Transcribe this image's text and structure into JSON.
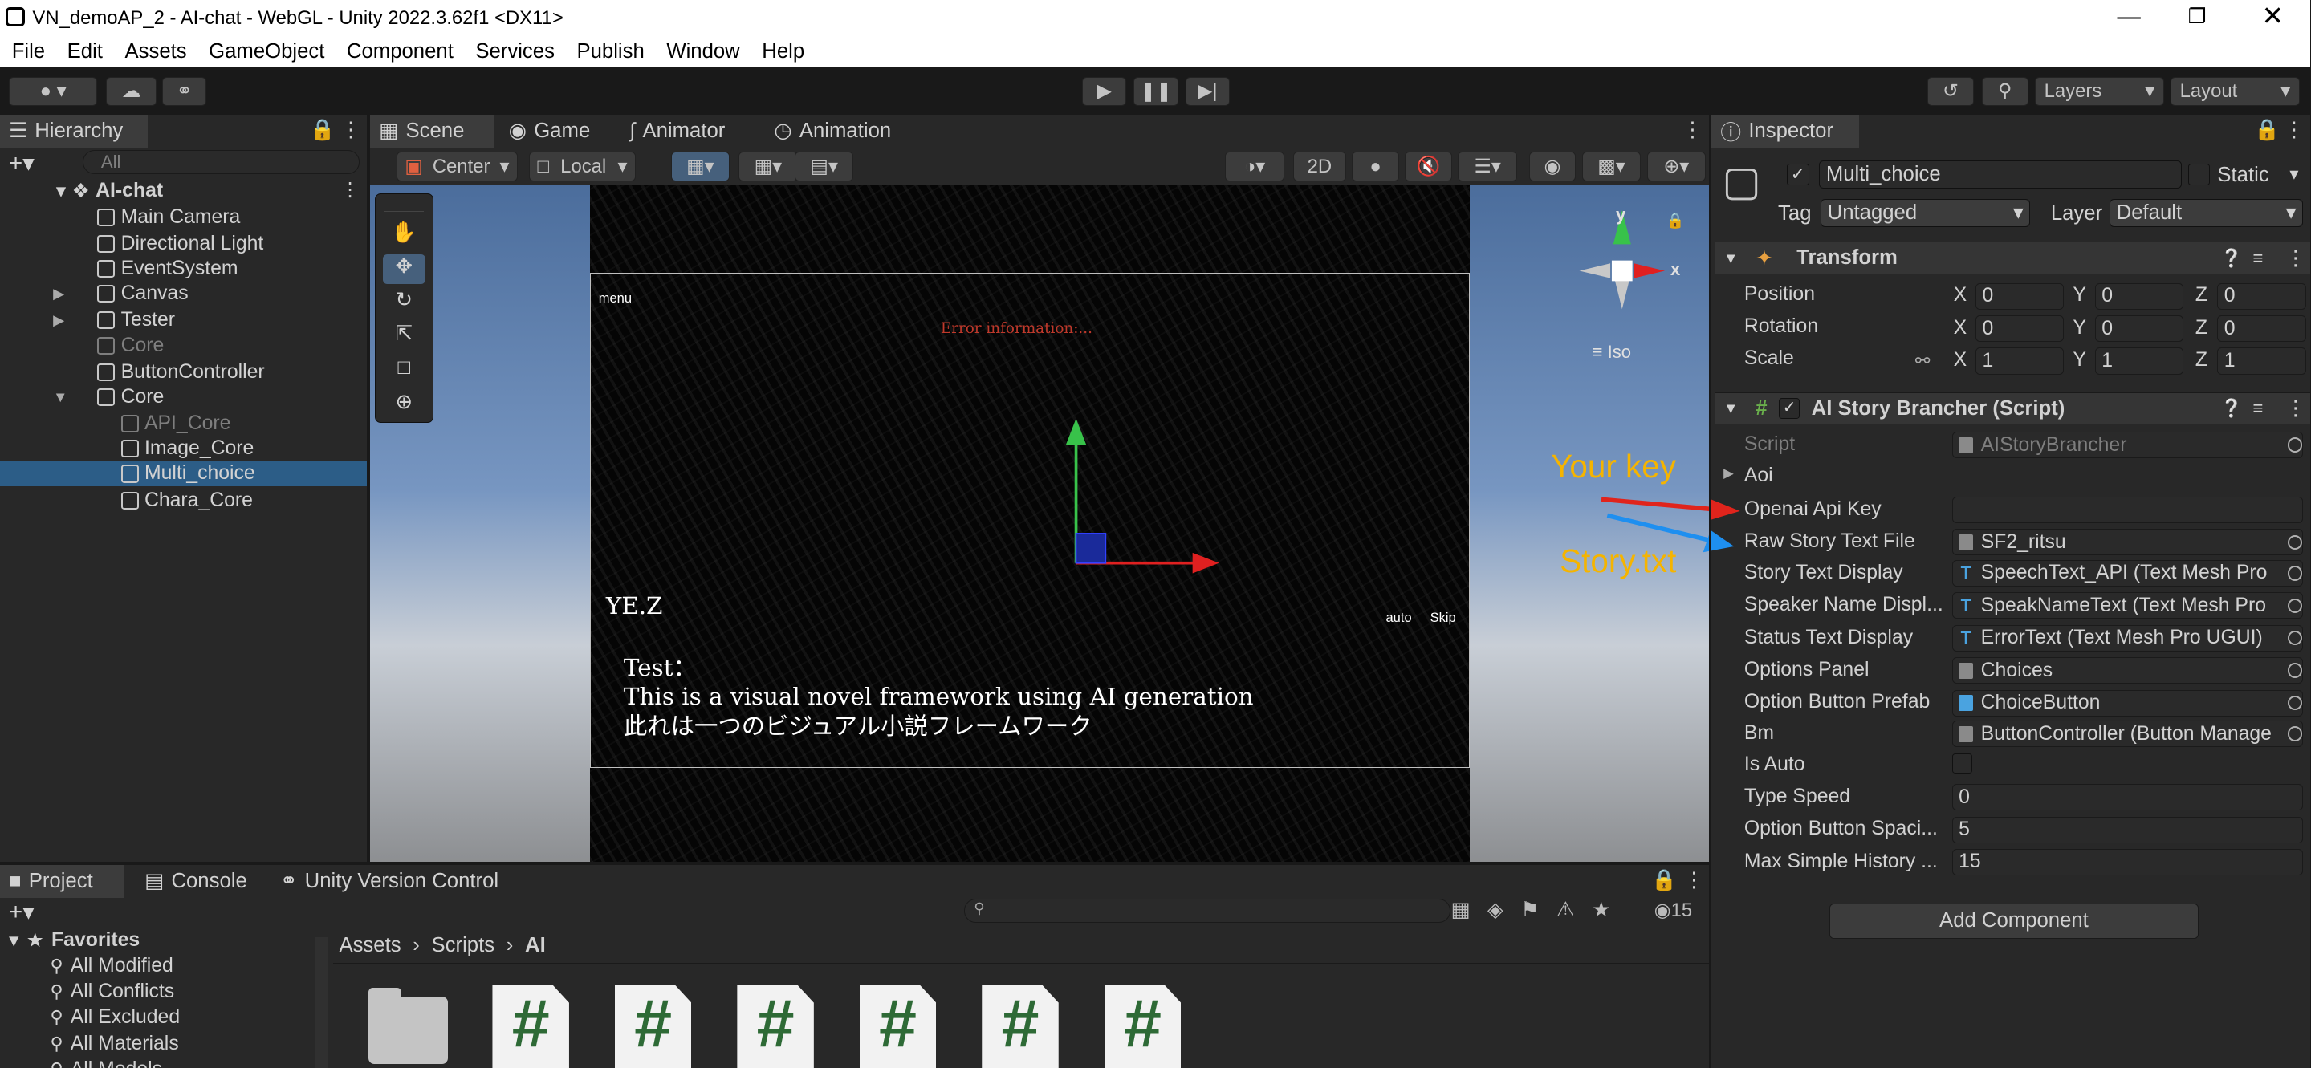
{
  "window": {
    "title": "VN_demoAP_2 - AI-chat - WebGL - Unity 2022.3.62f1 <DX11>"
  },
  "menu": [
    "File",
    "Edit",
    "Assets",
    "GameObject",
    "Component",
    "Services",
    "Publish",
    "Window",
    "Help"
  ],
  "toolbar": {
    "layers": "Layers",
    "layout": "Layout"
  },
  "hierarchy": {
    "tab": "Hierarchy",
    "search_placeholder": "All",
    "scene": "AI-chat",
    "items": [
      {
        "label": "Main Camera",
        "depth": 1,
        "dim": false,
        "expandable": false,
        "selected": false
      },
      {
        "label": "Directional Light",
        "depth": 1,
        "dim": false,
        "expandable": false,
        "selected": false
      },
      {
        "label": "EventSystem",
        "depth": 1,
        "dim": false,
        "expandable": false,
        "selected": false
      },
      {
        "label": "Canvas",
        "depth": 1,
        "dim": false,
        "expandable": true,
        "selected": false
      },
      {
        "label": "Tester",
        "depth": 1,
        "dim": false,
        "expandable": true,
        "selected": false
      },
      {
        "label": "Core",
        "depth": 1,
        "dim": true,
        "expandable": false,
        "selected": false
      },
      {
        "label": "ButtonController",
        "depth": 1,
        "dim": false,
        "expandable": false,
        "selected": false
      },
      {
        "label": "Core",
        "depth": 1,
        "dim": false,
        "expandable": true,
        "expanded": true,
        "selected": false
      },
      {
        "label": "API_Core",
        "depth": 2,
        "dim": true,
        "expandable": false,
        "selected": false
      },
      {
        "label": "Image_Core",
        "depth": 2,
        "dim": false,
        "expandable": false,
        "selected": false
      },
      {
        "label": "Multi_choice",
        "depth": 2,
        "dim": false,
        "expandable": false,
        "selected": true
      },
      {
        "label": "Chara_Core",
        "depth": 2,
        "dim": false,
        "expandable": false,
        "selected": false
      }
    ]
  },
  "scene_tabs": [
    "Scene",
    "Game",
    "Animator",
    "Animation"
  ],
  "scene_toolbar": {
    "pivot": "Center",
    "space": "Local",
    "mode_2d": "2D"
  },
  "gizmo": {
    "y": "y",
    "x": "x",
    "iso": "Iso"
  },
  "game_view": {
    "menu": "menu",
    "error": "Error information:...",
    "speaker": "YE.Z",
    "auto": "auto",
    "skip": "Skip",
    "line1": "Test：",
    "line2": "This is a visual novel framework using AI generation",
    "line3": "此れは一つのビジュアル小説フレームワーク"
  },
  "inspector": {
    "tab": "Inspector",
    "object_name": "Multi_choice",
    "static": "Static",
    "tag_label": "Tag",
    "tag": "Untagged",
    "layer_label": "Layer",
    "layer": "Default",
    "transform": {
      "title": "Transform",
      "position": {
        "label": "Position",
        "x": "0",
        "y": "0",
        "z": "0"
      },
      "rotation": {
        "label": "Rotation",
        "x": "0",
        "y": "0",
        "z": "0"
      },
      "scale": {
        "label": "Scale",
        "x": "1",
        "y": "1",
        "z": "1"
      }
    },
    "script_component": {
      "title": "AI Story Brancher (Script)",
      "fields": [
        {
          "label": "Script",
          "value": "AIStoryBrancher",
          "dim": true
        },
        {
          "label": "Aoi",
          "value": ""
        },
        {
          "label": "Openai Api Key",
          "value": ""
        },
        {
          "label": "Raw Story Text File",
          "value": "SF2_ritsu"
        },
        {
          "label": "Story Text Display",
          "value": "SpeechText_API (Text Mesh Pro"
        },
        {
          "label": "Speaker Name Displ...",
          "value": "SpeakNameText (Text Mesh Pro"
        },
        {
          "label": "Status Text Display",
          "value": "ErrorText (Text Mesh Pro UGUI)"
        },
        {
          "label": "Options Panel",
          "value": "Choices"
        },
        {
          "label": "Option Button Prefab",
          "value": "ChoiceButton"
        },
        {
          "label": "Bm",
          "value": "ButtonController (Button Manage"
        },
        {
          "label": "Is Auto",
          "value": ""
        },
        {
          "label": "Type Speed",
          "value": "0"
        },
        {
          "label": "Option Button Spaci...",
          "value": "5"
        },
        {
          "label": "Max Simple History ...",
          "value": "15"
        }
      ]
    },
    "add_component": "Add Component",
    "annotations": {
      "key": "Your key",
      "story": "Story.txt"
    }
  },
  "project": {
    "tabs": [
      "Project",
      "Console",
      "Unity Version Control"
    ],
    "badge": "15",
    "favorites_title": "Favorites",
    "favorites": [
      "All Modified",
      "All Conflicts",
      "All Excluded",
      "All Materials",
      "All Models"
    ],
    "breadcrumb": [
      "Assets",
      "Scripts",
      "AI"
    ]
  },
  "colors": {
    "accent": "#2c5d87",
    "annotation_text": "#f5b400",
    "arrow_red": "#e0241c",
    "arrow_blue": "#1e8ff0"
  }
}
